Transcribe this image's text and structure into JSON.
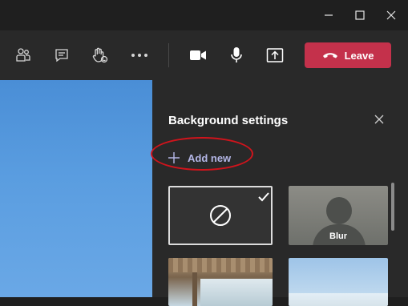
{
  "window": {
    "minimize_icon": "minimize-icon",
    "maximize_icon": "maximize-icon",
    "close_icon": "close-icon"
  },
  "toolbar": {
    "buttons": [
      {
        "name": "participants-button",
        "icon": "people-icon"
      },
      {
        "name": "chat-button",
        "icon": "chat-icon"
      },
      {
        "name": "raise-hand-button",
        "icon": "hand-icon"
      },
      {
        "name": "more-actions-button",
        "icon": "more-icon"
      },
      {
        "name": "camera-button",
        "icon": "camera-icon"
      },
      {
        "name": "mic-button",
        "icon": "mic-icon"
      },
      {
        "name": "share-button",
        "icon": "share-icon"
      }
    ],
    "leave_label": "Leave",
    "leave_color": "#c4314b"
  },
  "panel": {
    "title": "Background settings",
    "add_new_label": "Add new",
    "annotation_color": "#d0141c",
    "backgrounds": [
      {
        "name": "none",
        "selected": true,
        "label": ""
      },
      {
        "name": "blur",
        "selected": false,
        "label": "Blur"
      },
      {
        "name": "office",
        "selected": false,
        "label": ""
      },
      {
        "name": "sky",
        "selected": false,
        "label": ""
      }
    ]
  }
}
